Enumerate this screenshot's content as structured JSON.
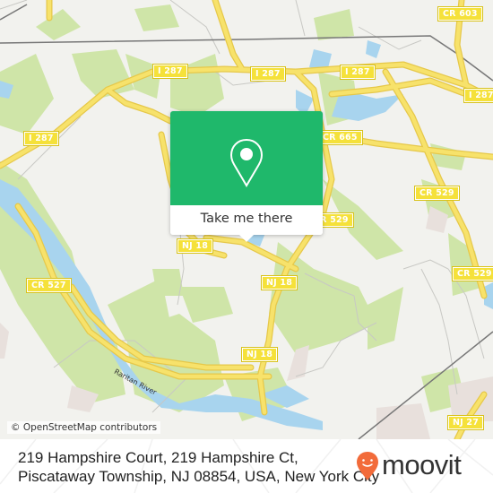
{
  "map": {
    "road_labels": [
      {
        "id": "i287-a",
        "text": "I 287"
      },
      {
        "id": "i287-b",
        "text": "I 287"
      },
      {
        "id": "i287-c",
        "text": "I 287"
      },
      {
        "id": "i287-d",
        "text": "I 287"
      },
      {
        "id": "i287-e",
        "text": "I 287"
      },
      {
        "id": "cr603",
        "text": "CR 603"
      },
      {
        "id": "cr665",
        "text": "CR 665"
      },
      {
        "id": "cr529-a",
        "text": "CR 529"
      },
      {
        "id": "cr529-b",
        "text": "CR 529"
      },
      {
        "id": "cr529-c",
        "text": "CR 529"
      },
      {
        "id": "cr527",
        "text": "CR 527"
      },
      {
        "id": "nj18-a",
        "text": "NJ 18"
      },
      {
        "id": "nj18-b",
        "text": "NJ 18"
      },
      {
        "id": "nj18-c",
        "text": "NJ 18"
      },
      {
        "id": "nj27",
        "text": "NJ 27"
      }
    ],
    "river_label": "Raritan River",
    "attribution": "© OpenStreetMap contributors",
    "colors": {
      "background": "#f2f2ee",
      "park": "#cfe5a8",
      "water": "#a8d4ee",
      "road": "#f7e26b",
      "rail": "#777777"
    }
  },
  "popup": {
    "button_label": "Take me there",
    "icon": "map-pin-icon",
    "color": "#1fb86b"
  },
  "footer": {
    "address_line1": "219 Hampshire Court, 219 Hampshire Ct,",
    "address_line2": "Piscataway Township, NJ 08854, USA, New York City",
    "brand": "moovit",
    "brand_color": "#f26b3a"
  }
}
